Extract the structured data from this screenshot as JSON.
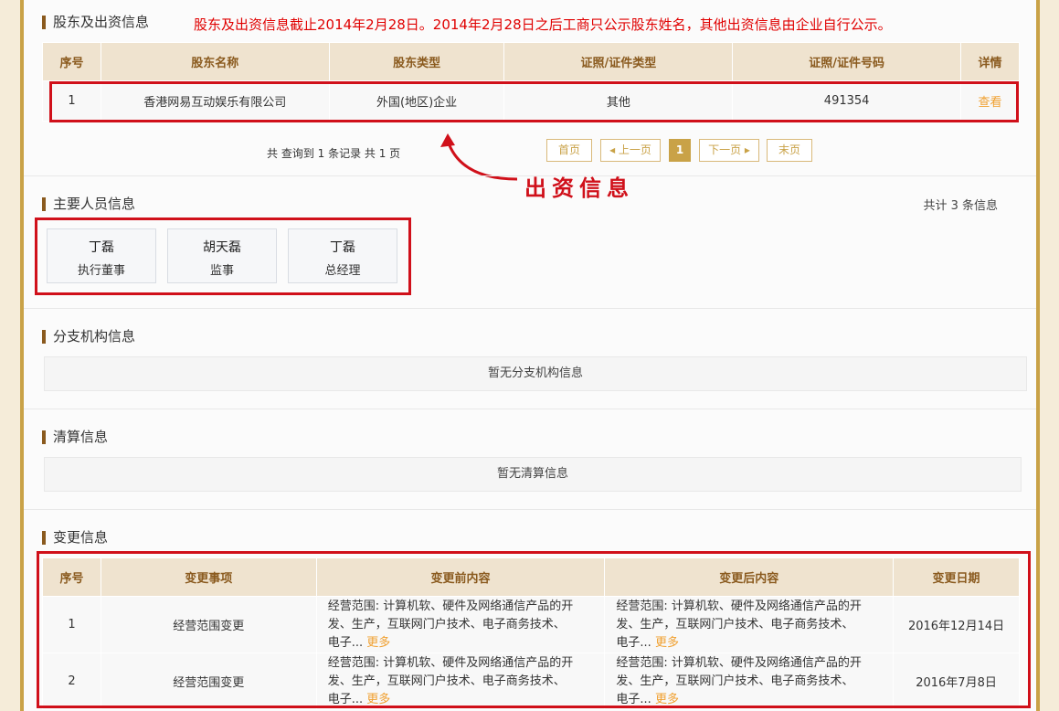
{
  "shareholders": {
    "title": "股东及出资信息",
    "notice": "股东及出资信息截止2014年2月28日。2014年2月28日之后工商只公示股东姓名，其他出资信息由企业自行公示。",
    "headers": [
      "序号",
      "股东名称",
      "股东类型",
      "证照/证件类型",
      "证照/证件号码",
      "详情"
    ],
    "rows": [
      {
        "index": "1",
        "name": "香港网易互动娱乐有限公司",
        "type": "外国(地区)企业",
        "cert_type": "其他",
        "cert_no": "491354",
        "detail": "查看"
      }
    ],
    "pager": {
      "info": "共 查询到 1 条记录 共 1 页",
      "first": "首页",
      "prev": "◂ 上一页",
      "current": "1",
      "next": "下一页 ▸",
      "last": "末页"
    },
    "annotation": "出资信息"
  },
  "personnel": {
    "title": "主要人员信息",
    "count": "共计 3 条信息",
    "people": [
      {
        "name": "丁磊",
        "position": "执行董事"
      },
      {
        "name": "胡天磊",
        "position": "监事"
      },
      {
        "name": "丁磊",
        "position": "总经理"
      }
    ]
  },
  "branches": {
    "title": "分支机构信息",
    "empty": "暂无分支机构信息"
  },
  "liquidation": {
    "title": "清算信息",
    "empty": "暂无清算信息"
  },
  "changes": {
    "title": "变更信息",
    "headers": [
      "序号",
      "变更事项",
      "变更前内容",
      "变更后内容",
      "变更日期"
    ],
    "more": "更多",
    "rows": [
      {
        "index": "1",
        "item": "经营范围变更",
        "before_l1": "经营范围: 计算机软、硬件及网络通信产品的开",
        "before_l2": "发、生产，互联网门户技术、电子商务技术、",
        "before_l3": "电子...",
        "after_l1": "经营范围: 计算机软、硬件及网络通信产品的开",
        "after_l2": "发、生产，互联网门户技术、电子商务技术、",
        "after_l3": "电子...",
        "date": "2016年12月14日"
      },
      {
        "index": "2",
        "item": "经营范围变更",
        "before_l1": "经营范围: 计算机软、硬件及网络通信产品的开",
        "before_l2": "发、生产，互联网门户技术、电子商务技术、",
        "before_l3": "电子...",
        "after_l1": "经营范围: 计算机软、硬件及网络通信产品的开",
        "after_l2": "发、生产，互联网门户技术、电子商务技术、",
        "after_l3": "电子...",
        "date": "2016年7月8日"
      }
    ]
  },
  "colors": {
    "accent": "#c9a247",
    "header_bg": "#efe3cf",
    "highlight": "#d0101a",
    "link": "#f0a030"
  }
}
